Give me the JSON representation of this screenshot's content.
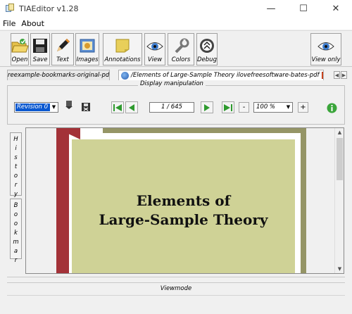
{
  "window": {
    "title": "TIAEditor v1.28",
    "minimize": "—",
    "maximize": "☐",
    "close": "✕"
  },
  "menu": {
    "items": [
      "File",
      "About"
    ]
  },
  "toolbar": {
    "open": "Open",
    "save": "Save",
    "text": "Text",
    "images": "Images",
    "annotations": "Annotations",
    "view": "View",
    "colors": "Colors",
    "debug": "Debug",
    "view_only": "View only"
  },
  "tabs": [
    {
      "label": "reexample-bookmarks-original-pdf",
      "close": "✕"
    },
    {
      "label": "/Elements of Large-Sample Theory ilovefreesoftware-bates-pdf",
      "close": "✕"
    }
  ],
  "display": {
    "group_title": "Display manipulation",
    "revision": "Revision 0",
    "page": "1 / 645",
    "zoom": "100 %",
    "zoom_minus": "-",
    "zoom_plus": "+"
  },
  "side": {
    "history": [
      "H",
      "i",
      "s",
      "t",
      "o",
      "r",
      "y"
    ],
    "bookmarks": [
      "B",
      "o",
      "o",
      "k",
      "m",
      "a",
      "r"
    ]
  },
  "document": {
    "title_line1": "Elements of",
    "title_line2": "Large-Sample Theory"
  },
  "status": {
    "mode": "Viewmode"
  },
  "colors": {
    "accent": "#0a58d0",
    "nav_green": "#2e9a2e",
    "cover_red": "#a33238",
    "cover_olive": "#959566",
    "cover_panel": "#cfd296"
  }
}
